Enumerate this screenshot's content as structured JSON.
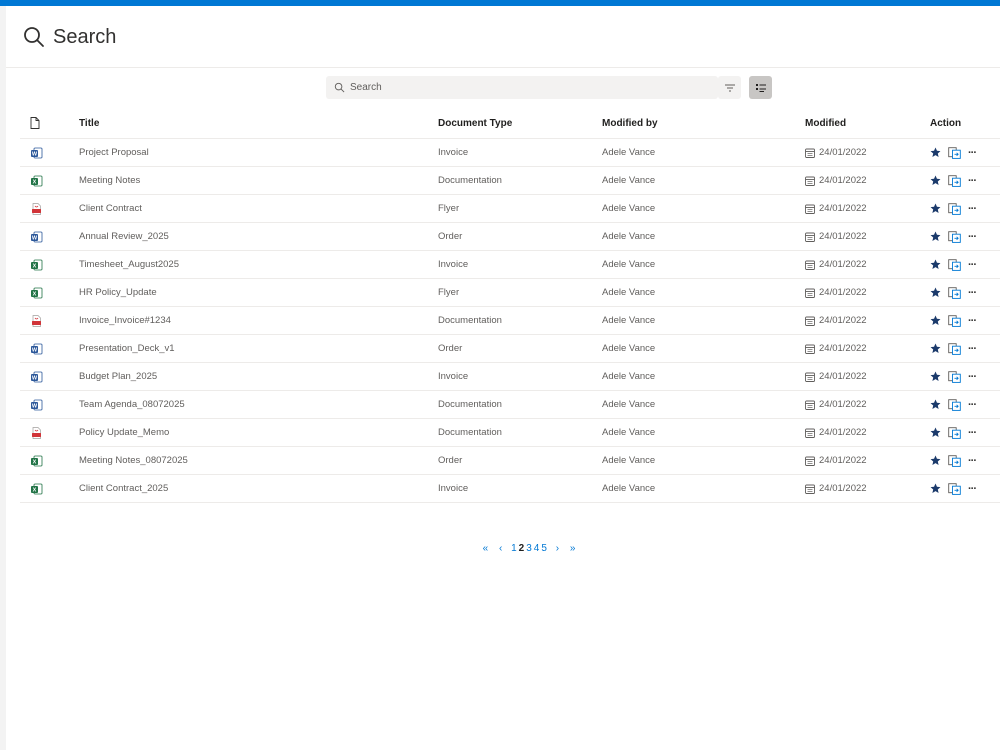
{
  "header": {
    "title": "Search"
  },
  "search": {
    "placeholder": "Search"
  },
  "table": {
    "columns": {
      "title": "Title",
      "type": "Document Type",
      "modified_by": "Modified by",
      "modified": "Modified",
      "action": "Action"
    },
    "rows": [
      {
        "icon": "word-file-icon",
        "title": "Project Proposal",
        "type": "Invoice",
        "modified_by": "Adele Vance",
        "modified": "24/01/2022"
      },
      {
        "icon": "excel-file-icon",
        "title": "Meeting Notes",
        "type": "Documentation",
        "modified_by": "Adele Vance",
        "modified": "24/01/2022"
      },
      {
        "icon": "pdf-file-icon",
        "title": "Client Contract",
        "type": "Flyer",
        "modified_by": "Adele Vance",
        "modified": "24/01/2022"
      },
      {
        "icon": "word-file-icon",
        "title": "Annual Review_2025",
        "type": "Order",
        "modified_by": "Adele Vance",
        "modified": "24/01/2022"
      },
      {
        "icon": "excel-file-icon",
        "title": "Timesheet_August2025",
        "type": "Invoice",
        "modified_by": "Adele Vance",
        "modified": "24/01/2022"
      },
      {
        "icon": "excel-file-icon",
        "title": "HR Policy_Update",
        "type": "Flyer",
        "modified_by": "Adele Vance",
        "modified": "24/01/2022"
      },
      {
        "icon": "pdf-file-icon",
        "title": "Invoice_Invoice#1234",
        "type": "Documentation",
        "modified_by": "Adele Vance",
        "modified": "24/01/2022"
      },
      {
        "icon": "word-file-icon",
        "title": "Presentation_Deck_v1",
        "type": "Order",
        "modified_by": "Adele Vance",
        "modified": "24/01/2022"
      },
      {
        "icon": "word-file-icon",
        "title": "Budget Plan_2025",
        "type": "Invoice",
        "modified_by": "Adele Vance",
        "modified": "24/01/2022"
      },
      {
        "icon": "word-file-icon",
        "title": "Team Agenda_08072025",
        "type": "Documentation",
        "modified_by": "Adele Vance",
        "modified": "24/01/2022"
      },
      {
        "icon": "pdf-file-icon",
        "title": "Policy Update_Memo",
        "type": "Documentation",
        "modified_by": "Adele Vance",
        "modified": "24/01/2022"
      },
      {
        "icon": "excel-file-icon",
        "title": "Meeting Notes_08072025",
        "type": "Order",
        "modified_by": "Adele Vance",
        "modified": "24/01/2022"
      },
      {
        "icon": "excel-file-icon",
        "title": "Client Contract_2025",
        "type": "Invoice",
        "modified_by": "Adele Vance",
        "modified": "24/01/2022"
      }
    ]
  },
  "pagination": {
    "first": "«",
    "prev": "‹",
    "pages": [
      "1",
      "2",
      "3",
      "4",
      "5"
    ],
    "current": "2",
    "next": "›",
    "last": "»"
  },
  "colors": {
    "accent": "#0078d4",
    "star": "#1b3a6b",
    "word": "#2b579a",
    "excel": "#217346",
    "pdf": "#d13438"
  }
}
